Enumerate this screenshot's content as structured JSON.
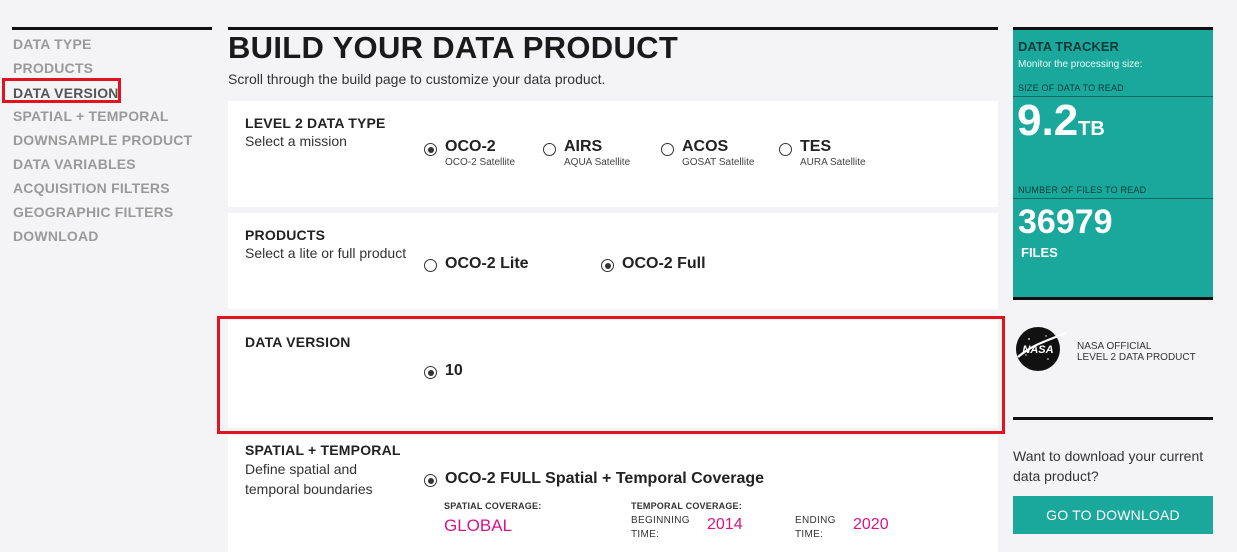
{
  "nav": {
    "items": [
      {
        "label": "DATA TYPE"
      },
      {
        "label": "PRODUCTS"
      },
      {
        "label": "DATA VERSION"
      },
      {
        "label": "SPATIAL + TEMPORAL"
      },
      {
        "label": "DOWNSAMPLE PRODUCT"
      },
      {
        "label": "DATA VARIABLES"
      },
      {
        "label": "ACQUISITION FILTERS"
      },
      {
        "label": "GEOGRAPHIC FILTERS"
      },
      {
        "label": "DOWNLOAD"
      }
    ],
    "active_index": 2
  },
  "header": {
    "title": "BUILD YOUR DATA PRODUCT",
    "subtitle": "Scroll through the build page to customize your data product."
  },
  "level2": {
    "title": "LEVEL 2 DATA TYPE",
    "desc": "Select a mission",
    "options": [
      {
        "label": "OCO-2",
        "sub": "OCO-2 Satellite",
        "checked": true
      },
      {
        "label": "AIRS",
        "sub": "AQUA Satellite",
        "checked": false
      },
      {
        "label": "ACOS",
        "sub": "GOSAT Satellite",
        "checked": false
      },
      {
        "label": "TES",
        "sub": "AURA Satellite",
        "checked": false
      }
    ]
  },
  "products": {
    "title": "PRODUCTS",
    "desc": "Select a lite or full product",
    "options": [
      {
        "label": "OCO-2 Lite",
        "checked": false
      },
      {
        "label": "OCO-2 Full",
        "checked": true
      }
    ]
  },
  "data_version": {
    "title": "DATA VERSION",
    "options": [
      {
        "label": "10",
        "checked": true
      }
    ]
  },
  "spatial": {
    "title": "SPATIAL + TEMPORAL",
    "desc_line1": "Define spatial and",
    "desc_line2": "temporal boundaries",
    "option_label": "OCO-2 FULL Spatial + Temporal Coverage",
    "spatial_cap": "SPATIAL COVERAGE:",
    "spatial_value": "GLOBAL",
    "temporal_cap": "TEMPORAL COVERAGE:",
    "begin_label_1": "BEGINNING",
    "begin_label_2": "TIME:",
    "begin_value": "2014",
    "end_label_1": "ENDING",
    "end_label_2": "TIME:",
    "end_value": "2020"
  },
  "tracker": {
    "title": "DATA TRACKER",
    "subtitle": "Monitor the processing size:",
    "size_caption": "SIZE OF DATA TO READ",
    "size_value": "9.2",
    "size_unit": "TB",
    "files_caption": "NUMBER OF FILES TO READ",
    "files_value": "36979",
    "files_unit": "FILES"
  },
  "nasa": {
    "logo_text": "NASA",
    "line1": "NASA OFFICIAL",
    "line2": "LEVEL 2 DATA PRODUCT"
  },
  "download": {
    "prompt": "Want to download your current data product?",
    "button": "GO TO DOWNLOAD"
  },
  "colors": {
    "accent": "#1aa89c",
    "highlight": "#e0141e",
    "magenta": "#d6148a"
  }
}
